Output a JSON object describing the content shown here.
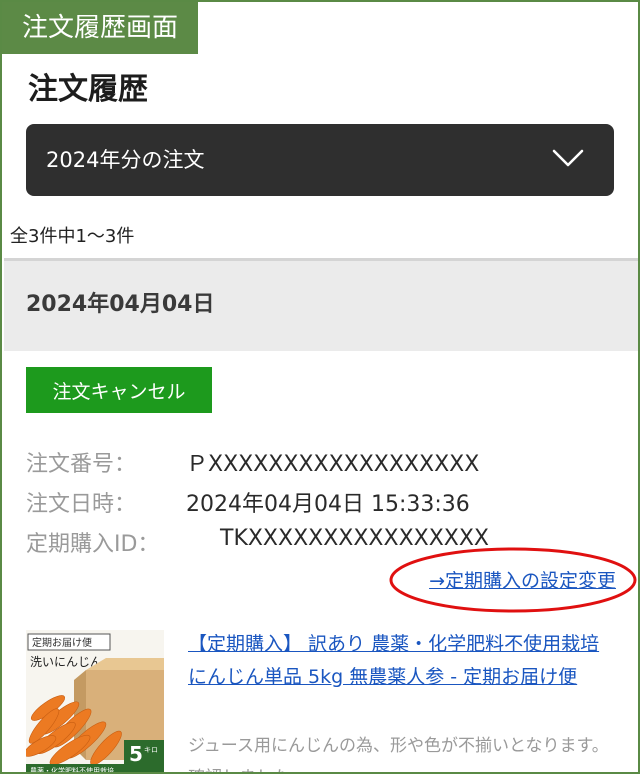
{
  "screen_tag": "注文履歴画面",
  "page_title": "注文履歴",
  "year_filter": {
    "selected": "2024年分の注文"
  },
  "result_count": "全3件中1～3件",
  "order": {
    "date": "2024年04月04日",
    "cancel_label": "注文キャンセル",
    "fields": [
      {
        "label": "注文番号：",
        "value": "ＰXXXXXXXXXXXXXXXXXX"
      },
      {
        "label": "注文日時：",
        "value": "2024年04月04日 15:33:36"
      },
      {
        "label": "定期購入ID：",
        "value": "TKXXXXXXXXXXXXXXXX"
      }
    ],
    "settings_link": "→定期購入の設定変更",
    "product": {
      "name": "【定期購入】 訳あり 農薬・化学肥料不使用栽培にんじん単品 5kg 無農薬人参 - 定期お届け便",
      "description": "ジュース用にんじんの為、形や色が不揃いとなります。 確認しました",
      "image_text": {
        "tag": "定期お届け便",
        "headline": "洗いにんじん",
        "weight": "5",
        "unit": "キロ",
        "footer": "農薬・化学肥料不使用栽培"
      }
    }
  },
  "colors": {
    "tag_green": "#5c8a46",
    "select_dark": "#2f2f2f",
    "cancel_green": "#1d9a1d",
    "link_blue": "#1a56c0",
    "highlight_red": "#e01010"
  }
}
